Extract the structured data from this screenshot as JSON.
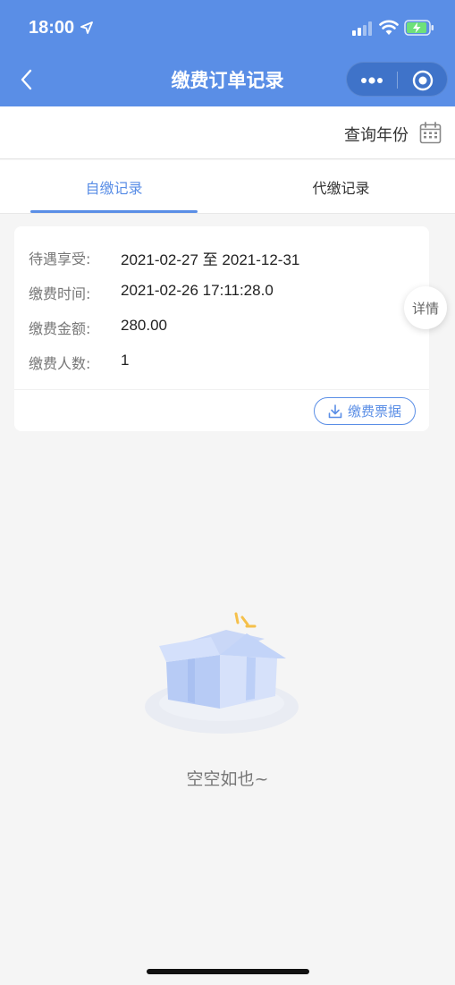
{
  "status_bar": {
    "time": "18:00",
    "icons": [
      "location-arrow-icon",
      "signal-icon",
      "wifi-icon",
      "battery-charging-icon"
    ]
  },
  "nav": {
    "title": "缴费订单记录",
    "back_icon": "chevron-left-icon",
    "more_icon": "more-dots-icon",
    "close_icon": "target-close-icon"
  },
  "query": {
    "label": "查询年份",
    "icon": "calendar-icon"
  },
  "tabs": [
    {
      "label": "自缴记录",
      "active": true
    },
    {
      "label": "代缴记录",
      "active": false
    }
  ],
  "record": {
    "rows": [
      {
        "key": "待遇享受:",
        "value": "2021-02-27 至 2021-12-31"
      },
      {
        "key": "缴费时间:",
        "value": "2021-02-26 17:11:28.0"
      },
      {
        "key": "缴费金额:",
        "value": "280.00"
      },
      {
        "key": "缴费人数:",
        "value": "1"
      }
    ],
    "receipt_button": "缴费票据",
    "detail_button": "详情"
  },
  "empty_state": {
    "text": "空空如也~",
    "icon": "empty-box-icon"
  },
  "colors": {
    "primary": "#5a8ee6",
    "background": "#f5f5f5"
  }
}
